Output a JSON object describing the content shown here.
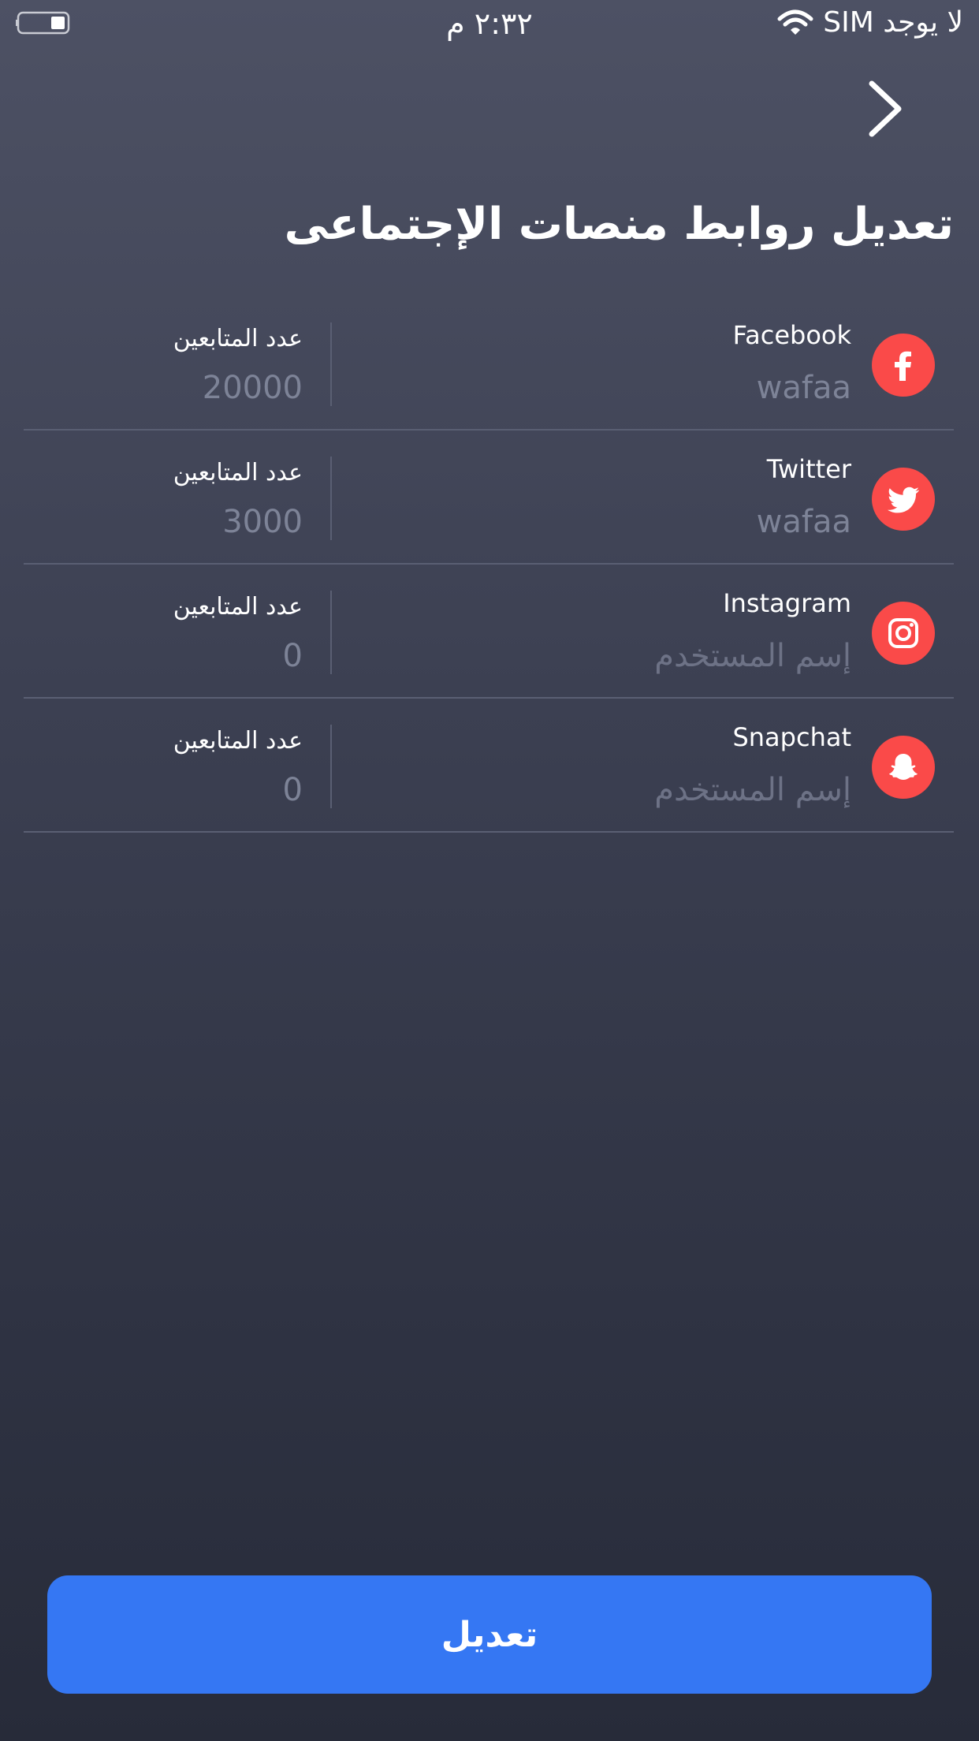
{
  "status_bar": {
    "carrier": "لا يوجد SIM",
    "time": "٢:٣٢ م"
  },
  "header": {
    "title": "تعديل روابط منصات الإجتماعى"
  },
  "platforms": [
    {
      "name": "Facebook",
      "icon": "facebook-icon",
      "username": "wafaa",
      "username_placeholder": "إسم المستخدم",
      "followers_label": "عدد المتابعين",
      "followers": "20000"
    },
    {
      "name": "Twitter",
      "icon": "twitter-icon",
      "username": "wafaa",
      "username_placeholder": "إسم المستخدم",
      "followers_label": "عدد المتابعين",
      "followers": "3000"
    },
    {
      "name": "Instagram",
      "icon": "instagram-icon",
      "username": "",
      "username_placeholder": "إسم المستخدم",
      "followers_label": "عدد المتابعين",
      "followers": "0"
    },
    {
      "name": "Snapchat",
      "icon": "snapchat-icon",
      "username": "",
      "username_placeholder": "إسم المستخدم",
      "followers_label": "عدد المتابعين",
      "followers": "0"
    }
  ],
  "submit": {
    "label": "تعديل"
  },
  "colors": {
    "icon_bg": "#fa4a49",
    "button_bg": "#3577f3",
    "input_text": "#7d8397"
  }
}
